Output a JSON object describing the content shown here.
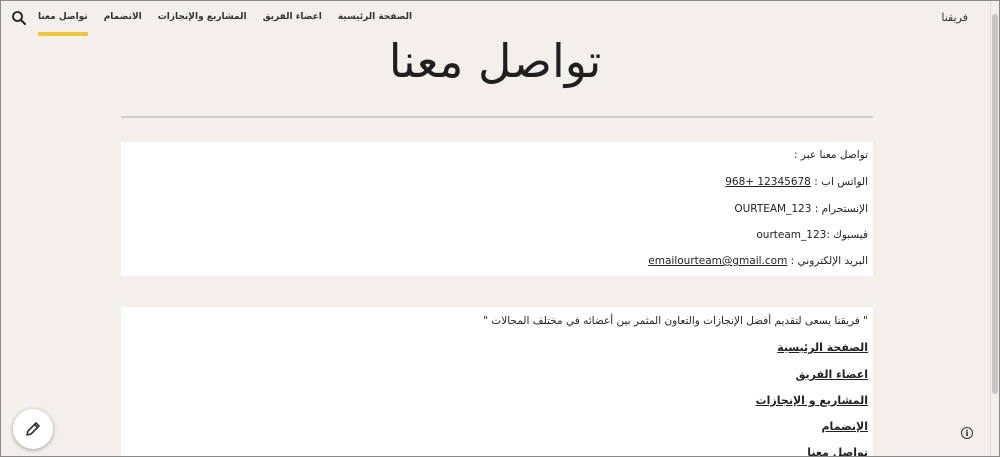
{
  "header": {
    "brand": "فريقنا",
    "nav": [
      {
        "label": "الصفحة الرئيسية",
        "active": false
      },
      {
        "label": "اعضاء الفريق",
        "active": false
      },
      {
        "label": "المشاريع والإنجازات",
        "active": false
      },
      {
        "label": "الانضمام",
        "active": false
      },
      {
        "label": "تواصل معنا",
        "active": true
      }
    ],
    "search_icon": "search-icon"
  },
  "page": {
    "title": "تواصل معنا"
  },
  "contact": {
    "intro": "تواصل معنا عبر :",
    "whatsapp_label": "الواتس اب :",
    "whatsapp_value": "968+ 12345678",
    "instagram": "الإنستجرام : OURTEAM_123",
    "facebook": "فيسبوك :ourteam_123",
    "email_label": "البريد الإلكتروني :",
    "email_value": "emailourteam@gmail.com"
  },
  "footer_box": {
    "quote": "\" فريقنا يسعى لتقديم أفضل الإنجازات والتعاون المثمر بين أعضائه في مختلف المجالات \"",
    "links": [
      "الصفحة الرئيسية",
      "اعضاء الفريق",
      "المشاريع و الإنجازات",
      "الإنضمام",
      "تواصل معنا"
    ]
  },
  "colors": {
    "background": "#f3f0ec",
    "accent": "#f4c430",
    "card": "#ffffff"
  }
}
